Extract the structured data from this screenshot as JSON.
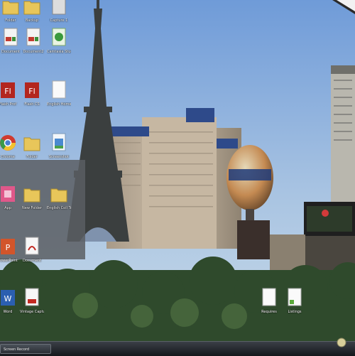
{
  "desktop": {
    "icons": [
      {
        "id": "top1",
        "label": "Folder",
        "kind": "folder"
      },
      {
        "id": "top2",
        "label": "Backup",
        "kind": "folder"
      },
      {
        "id": "top3",
        "label": "Capture 1",
        "kind": "file"
      },
      {
        "id": "r1c1",
        "label": "Document",
        "kind": "word-doc"
      },
      {
        "id": "r1c2",
        "label": "Document2",
        "kind": "word-doc"
      },
      {
        "id": "r1c3",
        "label": "Camtasia Studio",
        "kind": "camtasia"
      },
      {
        "id": "r2c1",
        "label": "Flash Prof",
        "kind": "flash"
      },
      {
        "id": "r2c2",
        "label": "Flash CS",
        "kind": "flash"
      },
      {
        "id": "r2c3",
        "label": "English Homework",
        "kind": "blank-doc"
      },
      {
        "id": "r3c1",
        "label": "Chrome",
        "kind": "chrome"
      },
      {
        "id": "r3c2",
        "label": "Folder",
        "kind": "folder"
      },
      {
        "id": "r3c3",
        "label": "Screenshot",
        "kind": "image"
      },
      {
        "id": "r4c1",
        "label": "App",
        "kind": "pink-app"
      },
      {
        "id": "r4c2",
        "label": "New Folder",
        "kind": "folder"
      },
      {
        "id": "r4c3",
        "label": "English Coll Templates",
        "kind": "folder"
      },
      {
        "id": "r5c1",
        "label": "PowerPoint",
        "kind": "ppt"
      },
      {
        "id": "r5c2",
        "label": "Document",
        "kind": "pdf"
      },
      {
        "id": "r6c1",
        "label": "Word",
        "kind": "word"
      },
      {
        "id": "r6c2",
        "label": "Vintage Capture 1",
        "kind": "pdf-doc"
      },
      {
        "id": "br1",
        "label": "Requires",
        "kind": "blank-doc"
      },
      {
        "id": "br2",
        "label": "Listings",
        "kind": "doc-green"
      }
    ]
  },
  "taskbar": {
    "task_label": "Screen Record"
  },
  "colors": {
    "sky_top": "#6f9bd8",
    "sky_bottom": "#c9dbe9",
    "taskbar": "#1d2126"
  }
}
